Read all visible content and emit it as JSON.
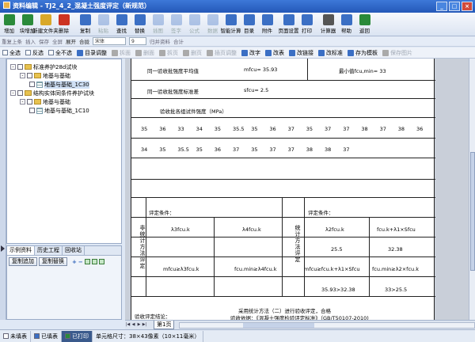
{
  "title": "资料编辑 - TJ2_4_2_混凝土强度评定（新规范）",
  "toolbar": [
    {
      "label": "增加",
      "color": "#2a8a3a",
      "dis": false
    },
    {
      "label": "块增加",
      "color": "#2a8a3a",
      "dis": false
    },
    {
      "label": "新建文件夹",
      "color": "#d9a829",
      "dis": false
    },
    {
      "label": "删除",
      "color": "#cc3322",
      "dis": false
    },
    {
      "label": "",
      "color": "",
      "dis": false,
      "sep": true
    },
    {
      "label": "复制",
      "color": "#3b6fc4",
      "dis": false
    },
    {
      "label": "粘贴",
      "color": "#3b6fc4",
      "dis": true
    },
    {
      "label": "查找",
      "color": "#3b6fc4",
      "dis": false
    },
    {
      "label": "替换",
      "color": "#3b6fc4",
      "dis": false
    },
    {
      "label": "插图",
      "color": "#3b6fc4",
      "dis": true
    },
    {
      "label": "签字",
      "color": "#3b6fc4",
      "dis": true
    },
    {
      "label": "公式",
      "color": "#3b6fc4",
      "dis": true
    },
    {
      "label": "数据",
      "color": "#3b6fc4",
      "dis": true
    },
    {
      "label": "智能计算",
      "color": "#3b6fc4",
      "dis": false
    },
    {
      "label": "目录",
      "color": "#3b6fc4",
      "dis": false
    },
    {
      "label": "附件",
      "color": "#3b6fc4",
      "dis": false
    },
    {
      "label": "",
      "color": "",
      "dis": false,
      "sep": true
    },
    {
      "label": "页面设置",
      "color": "#3b6fc4",
      "dis": false
    },
    {
      "label": "打印",
      "color": "#3b6fc4",
      "dis": false
    },
    {
      "label": "",
      "color": "",
      "dis": false,
      "sep": true
    },
    {
      "label": "计算器",
      "color": "#555",
      "dis": false
    },
    {
      "label": "帮助",
      "color": "#3b6fc4",
      "dis": false
    },
    {
      "label": "返回",
      "color": "#2a8a3a",
      "dis": false
    }
  ],
  "fmtbar": {
    "items": [
      "重复上条",
      "插入",
      "保存",
      "全屏",
      "展开",
      "合拢",
      "归并资料",
      "合计"
    ],
    "font": "宋体",
    "size": "9"
  },
  "actbar": [
    {
      "label": "全选",
      "type": "cb",
      "dis": false
    },
    {
      "label": "反选",
      "type": "cb",
      "dis": false
    },
    {
      "label": "全不选",
      "type": "cb",
      "dis": false
    },
    {
      "label": "目录调整",
      "type": "ic",
      "color": "#3b6fc4",
      "dis": false
    },
    {
      "label": "拆面",
      "type": "ic",
      "color": "#aaa",
      "dis": true
    },
    {
      "label": "删面",
      "type": "ic",
      "color": "#aaa",
      "dis": true
    },
    {
      "label": "拆页",
      "type": "ic",
      "color": "#aaa",
      "dis": true
    },
    {
      "label": "删页",
      "type": "ic",
      "color": "#aaa",
      "dis": true
    },
    {
      "label": "插页调整",
      "type": "ic",
      "color": "#aaa",
      "dis": true
    },
    {
      "label": "改字",
      "type": "ic",
      "color": "#3b6fc4",
      "dis": false
    },
    {
      "label": "改表",
      "type": "ic",
      "color": "#3b6fc4",
      "dis": false
    },
    {
      "label": "改链接",
      "type": "ic",
      "color": "#3b6fc4",
      "dis": false
    },
    {
      "label": "改标准",
      "type": "ic",
      "color": "#3b6fc4",
      "dis": false
    },
    {
      "label": "存为模板",
      "type": "ic",
      "color": "#3b6fc4",
      "dis": false
    },
    {
      "label": "保存图片",
      "type": "ic",
      "color": "#aaa",
      "dis": true
    }
  ],
  "tree": [
    {
      "label": "标准养护28d试块",
      "level": 0,
      "kind": "fd",
      "pm": "-",
      "sel": false
    },
    {
      "label": "地基与基础",
      "level": 1,
      "kind": "fd",
      "pm": "-",
      "sel": false
    },
    {
      "label": "地基与基础_1C30",
      "level": 2,
      "kind": "gd",
      "pm": "",
      "sel": true
    },
    {
      "label": "结构实体同条件养护试块",
      "level": 0,
      "kind": "fd",
      "pm": "-",
      "sel": false
    },
    {
      "label": "地基与基础",
      "level": 1,
      "kind": "fd",
      "pm": "-",
      "sel": false
    },
    {
      "label": "地基与基础_1C10",
      "level": 2,
      "kind": "gd",
      "pm": "",
      "sel": false
    }
  ],
  "panel": {
    "tabs": [
      "示例资料",
      "历史工程",
      "回收站"
    ],
    "copy_add": "复制追加",
    "copy_replace": "复制替换"
  },
  "doc": {
    "row1_label": "同一验收批强度平均值",
    "row1_formula": "mfcu= 35.93",
    "row1_min": "最小值fcu,min= 33",
    "row2_label": "同一验收批强度标准差",
    "row2_formula": "sfcu= 2.5",
    "group_title": "验收批各组试件强度（MPa）",
    "vals1": [
      "35",
      "36",
      "33",
      "34",
      "35",
      "35.5",
      "35",
      "36",
      "37",
      "35",
      "37",
      "37",
      "38",
      "37",
      "38",
      "36"
    ],
    "vals2": [
      "34",
      "35",
      "35.5",
      "35",
      "36",
      "37",
      "35",
      "37",
      "37",
      "38",
      "38",
      "37"
    ],
    "left_title": "非统计方法评定",
    "right_title": "统计方法评定",
    "cond_left": "评定条件：",
    "cond_right": "评定条件：",
    "l_h1": "λ3fcu.k",
    "l_h2": "λ4fcu.k",
    "r_h1": "λ2fcu.k",
    "r_h2": "fcu.k+λ1×Sfcu",
    "r_v1": "25.5",
    "r_v2": "32.38",
    "l_c1": "mfcu≥λ3fcu.k",
    "l_c2": "fcu.min≥λ4fcu.k",
    "r_c1": "mfcu≥fcu.k+λ1×Sfcu",
    "r_c2": "fcu.min≥λ2×fcu.k",
    "r_r1": "35.93>32.38",
    "r_r2": "33>25.5",
    "conclusion_label": "验收评定结论：",
    "conclusion_1": "采用统计方法（二）进行验收评定，合格",
    "conclusion_2": "验收依据：《混凝土强度检验评定标准》（GB/T50107-2010)"
  },
  "sheet": "第1页",
  "status": [
    {
      "label": "未填表",
      "color": "#fff",
      "act": false
    },
    {
      "label": "已填表",
      "color": "#3b6fc4",
      "act": false
    },
    {
      "label": "已打印",
      "color": "#2a8a3a",
      "act": true
    },
    {
      "label": "单元格尺寸：38×43像素（10×11毫米）",
      "color": "",
      "act": false
    }
  ]
}
